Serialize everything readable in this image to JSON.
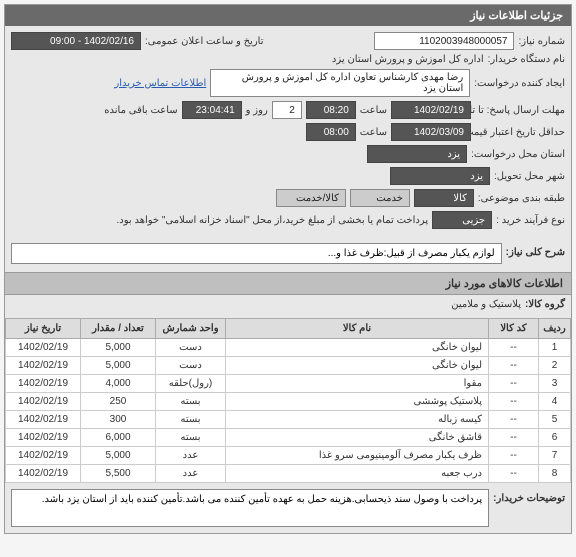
{
  "header": {
    "title": "جزئیات اطلاعات نیاز"
  },
  "form": {
    "need_no_label": "شماره نیاز:",
    "need_no": "1102003948000057",
    "public_announce_label": "تاریخ و ساعت اعلان عمومی:",
    "public_announce": "1402/02/16 - 09:00",
    "buyer_label": "نام دستگاه خریدار:",
    "buyer": "اداره کل اموزش و پرورش استان یزد",
    "creator_label": "ایجاد کننده درخواست:",
    "creator": "رضا مهدی کارشناس تعاون اداره کل اموزش و پرورش استان یزد",
    "contact_link": "اطلاعات تماس خریدار",
    "deadline_label": "مهلت ارسال پاسخ: تا تاریخ:",
    "deadline_date": "1402/02/19",
    "time_label": "ساعت",
    "deadline_time": "08:20",
    "days_label": "روز و",
    "days": "2",
    "remain_label": "ساعت باقی مانده",
    "remain_time": "23:04:41",
    "validity_label": "حداقل تاریخ اعتبار قیمت: تا تاریخ:",
    "validity_date": "1402/03/09",
    "validity_time": "08:00",
    "req_city_label": "استان محل درخواست:",
    "req_city": "یزد",
    "loc_label": "شهر محل تحویل:",
    "loc": "یزد",
    "cat_label": "طبقه بندی موضوعی:",
    "cat": "کالا",
    "service_label": "خدمت",
    "goods_service_label": "کالا/خدمت",
    "purchase_label": "نوع فرآیند خرید :",
    "purchase": "جزیی",
    "note": "پرداخت تمام یا بخشی از مبلغ خرید،از محل \"اسناد خزانه اسلامی\" خواهد بود."
  },
  "desc": {
    "label": "شرح کلی نیاز:",
    "text": "لوازم یکبار مصرف از قبیل:ظرف غذا و..."
  },
  "goods_header": "اطلاعات کالاهای مورد نیاز",
  "group": {
    "label": "گروه کالا:",
    "value": "پلاستیک و ملامین"
  },
  "table": {
    "headers": [
      "ردیف",
      "کد کالا",
      "نام کالا",
      "واحد شمارش",
      "تعداد / مقدار",
      "تاریخ نیاز"
    ],
    "rows": [
      [
        "1",
        "--",
        "لیوان خانگی",
        "دست",
        "5,000",
        "1402/02/19"
      ],
      [
        "2",
        "--",
        "لیوان خانگی",
        "دست",
        "5,000",
        "1402/02/19"
      ],
      [
        "3",
        "--",
        "مقوا",
        "(رول)حلقه",
        "4,000",
        "1402/02/19"
      ],
      [
        "4",
        "--",
        "پلاستیک پوششی",
        "بسته",
        "250",
        "1402/02/19"
      ],
      [
        "5",
        "--",
        "کیسه زباله",
        "بسته",
        "300",
        "1402/02/19"
      ],
      [
        "6",
        "--",
        "قاشق خانگی",
        "بسته",
        "6,000",
        "1402/02/19"
      ],
      [
        "7",
        "--",
        "ظرف یکبار مصرف آلومینیومی سرو غذا",
        "عدد",
        "5,000",
        "1402/02/19"
      ],
      [
        "8",
        "--",
        "درب جعبه",
        "عدد",
        "5,500",
        "1402/02/19"
      ]
    ]
  },
  "buyer_notes": {
    "label": "توضیحات خریدار:",
    "text": "پرداخت با وصول سند ذیحسابی.هزینه حمل به عهده تأمین کننده می باشد.تأمین کننده باید از استان یزد باشد."
  }
}
